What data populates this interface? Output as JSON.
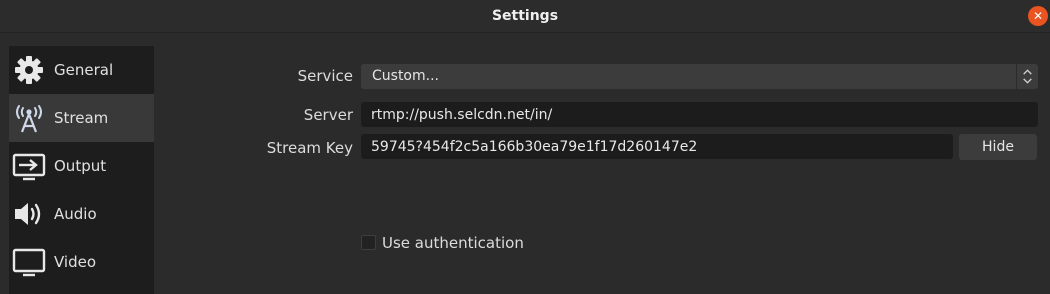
{
  "window": {
    "title": "Settings",
    "close_glyph": "✕"
  },
  "sidebar": {
    "items": [
      {
        "label": "General",
        "icon": "gear-icon",
        "selected": false
      },
      {
        "label": "Stream",
        "icon": "broadcast-icon",
        "selected": true
      },
      {
        "label": "Output",
        "icon": "output-icon",
        "selected": false
      },
      {
        "label": "Audio",
        "icon": "speaker-icon",
        "selected": false
      },
      {
        "label": "Video",
        "icon": "monitor-icon",
        "selected": false
      }
    ]
  },
  "stream": {
    "service_label": "Service",
    "service_value": "Custom...",
    "server_label": "Server",
    "server_value": "rtmp://push.selcdn.net/in/",
    "stream_key_label": "Stream Key",
    "stream_key_value": "59745?454f2c5a166b30ea79e1f17d260147e2",
    "hide_label": "Hide",
    "auth_label": "Use authentication",
    "auth_checked": false
  },
  "colors": {
    "accent_close": "#e95420",
    "selected_item_bg": "#393939"
  }
}
